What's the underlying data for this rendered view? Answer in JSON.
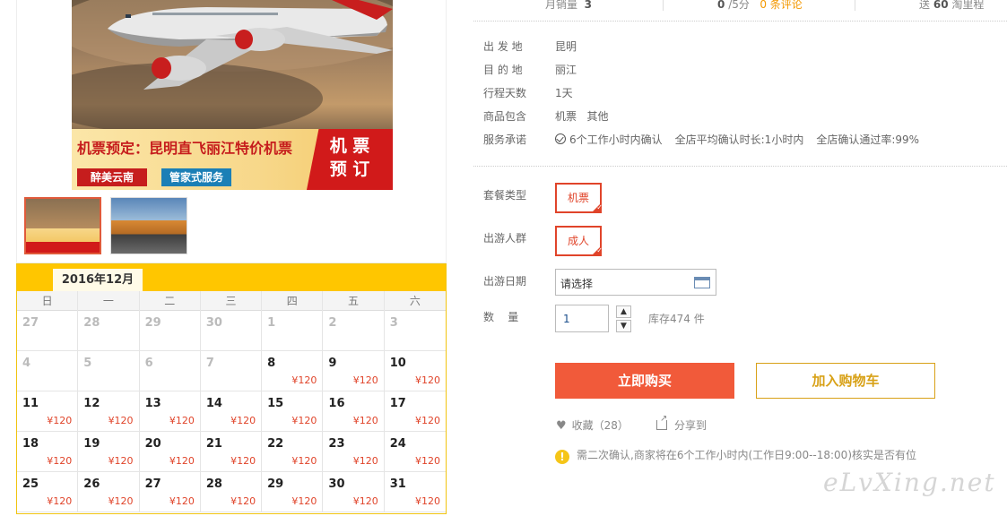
{
  "hero": {
    "headline": "机票预定：昆明直飞丽江特价机票",
    "tag_left": "醉美云南",
    "tag_right": "管家式服务",
    "stamp_line1": "机 票",
    "stamp_line2": "预 订"
  },
  "stats": {
    "monthly_sales_label": "月销量",
    "monthly_sales_value": "3",
    "rating_value": "0",
    "rating_suffix": "/5分",
    "reviews": "0 条评论",
    "points_prefix": "送",
    "points_value": "60",
    "points_suffix": "淘里程"
  },
  "attributes": [
    {
      "key": "出 发 地",
      "value": "昆明"
    },
    {
      "key": "目 的 地",
      "value": "丽江"
    },
    {
      "key": "行程天数",
      "value": "1天"
    },
    {
      "key": "商品包含",
      "value": "机票   其他"
    }
  ],
  "service": {
    "key": "服务承诺",
    "items": [
      "6个工作小时内确认",
      "全店平均确认时长:1小时内",
      "全店确认通过率:99%"
    ]
  },
  "options": {
    "package_label": "套餐类型",
    "package_value": "机票",
    "traveler_label": "出游人群",
    "traveler_value": "成人",
    "date_label": "出游日期",
    "date_placeholder": "请选择",
    "qty_label": "数    量",
    "qty_value": "1",
    "stock": "库存474 件"
  },
  "actions": {
    "buy": "立即购买",
    "cart": "加入购物车",
    "favorite": "收藏（28）",
    "share": "分享到"
  },
  "notice": "需二次确认,商家将在6个工作小时内(工作日9:00--18:00)核实是否有位",
  "watermark": "eLvXing.net",
  "calendar": {
    "month": "2016年12月",
    "weekdays": [
      "日",
      "一",
      "二",
      "三",
      "四",
      "五",
      "六"
    ],
    "price": "¥120",
    "days": [
      {
        "n": "27",
        "past": true
      },
      {
        "n": "28",
        "past": true
      },
      {
        "n": "29",
        "past": true
      },
      {
        "n": "30",
        "past": true
      },
      {
        "n": "1",
        "past": true
      },
      {
        "n": "2",
        "past": true
      },
      {
        "n": "3",
        "past": true
      },
      {
        "n": "4",
        "past": true
      },
      {
        "n": "5",
        "past": true
      },
      {
        "n": "6",
        "past": true
      },
      {
        "n": "7",
        "past": true
      },
      {
        "n": "8"
      },
      {
        "n": "9"
      },
      {
        "n": "10"
      },
      {
        "n": "11"
      },
      {
        "n": "12"
      },
      {
        "n": "13"
      },
      {
        "n": "14"
      },
      {
        "n": "15"
      },
      {
        "n": "16"
      },
      {
        "n": "17"
      },
      {
        "n": "18"
      },
      {
        "n": "19"
      },
      {
        "n": "20"
      },
      {
        "n": "21"
      },
      {
        "n": "22"
      },
      {
        "n": "23"
      },
      {
        "n": "24"
      },
      {
        "n": "25"
      },
      {
        "n": "26"
      },
      {
        "n": "27"
      },
      {
        "n": "28"
      },
      {
        "n": "29"
      },
      {
        "n": "30"
      },
      {
        "n": "31"
      }
    ]
  },
  "colors": {
    "accent": "#f15a3a",
    "calendar_header": "#ffc600",
    "price": "#e0442a",
    "cart": "#d8a117"
  }
}
